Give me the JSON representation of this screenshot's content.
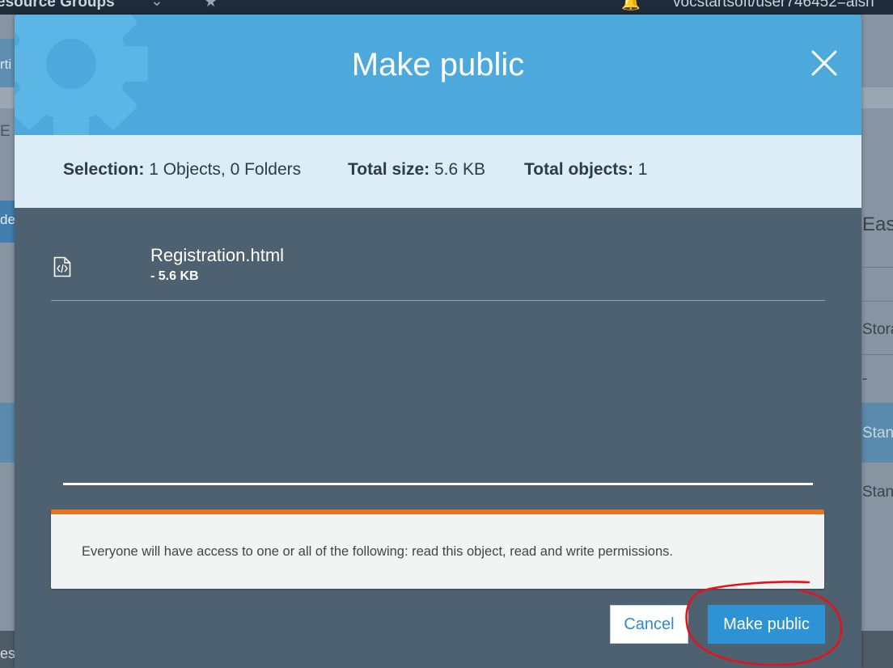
{
  "background": {
    "topbar": {
      "resource_groups": "esource Groups",
      "account": "vocstartsoft/user746452=aish"
    },
    "left_fragments": {
      "tab": "rti",
      "search": "E",
      "selected": "de",
      "bottom": "es"
    },
    "right_fragments": {
      "region": "Eas",
      "storage": "Stora",
      "dash": "-",
      "standard_1": "Stanc",
      "standard_2": "Stanc"
    }
  },
  "modal": {
    "title": "Make public",
    "summary": {
      "selection_label": "Selection:",
      "selection_value": "1 Objects, 0 Folders",
      "total_size_label": "Total size:",
      "total_size_value": "5.6 KB",
      "total_objects_label": "Total objects:",
      "total_objects_value": "1"
    },
    "files": [
      {
        "name": "Registration.html",
        "size": "- 5.6 KB",
        "icon": "html-file-icon"
      }
    ],
    "progress": 1.0,
    "warning": "Everyone will have access to one or all of the following: read this object, read and write permissions.",
    "buttons": {
      "cancel": "Cancel",
      "confirm": "Make public"
    }
  },
  "colors": {
    "header": "#4da8dc",
    "summary_bg": "#dcedf8",
    "body_bg": "#4e6170",
    "warning_accent": "#e8741e",
    "primary_button": "#2e93d4",
    "annotation_circle": "#e3131b"
  }
}
